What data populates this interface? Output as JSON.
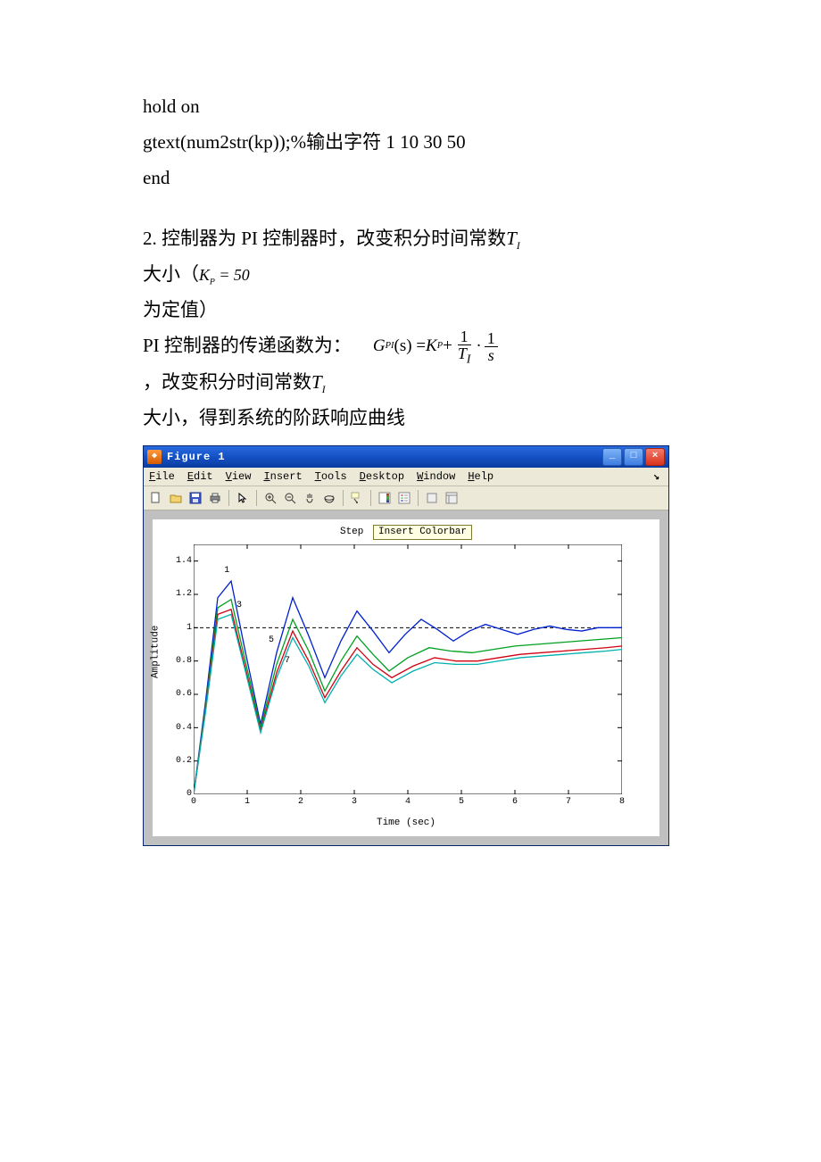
{
  "code": {
    "line1": " hold on",
    "line2": " gtext(num2str(kp));%输出字符 1 10 30 50",
    "line3": "end"
  },
  "section2": {
    "heading_prefix": "2. 控制器为 PI 控制器时，改变积分时间常数",
    "ti_var": "T",
    "ti_sub": "I",
    "size_prefix": "大小（",
    "kp_eq_lhs": "K",
    "kp_eq_sub": "P",
    "kp_eq": " = 50",
    "fixed_value": "为定值）",
    "tf_label": "PI 控制器的传递函数为：",
    "formula": {
      "lhs": "G",
      "lhs_sub": "PI",
      "of_s": "(s) = ",
      "kp": "K",
      "kp_sub": "P",
      "plus": " + ",
      "dot": " · "
    },
    "change_prefix": "，改变积分时间常数",
    "result_line": "大小，得到系统的阶跃响应曲线"
  },
  "figure": {
    "title": "Figure 1",
    "menu": [
      "File",
      "Edit",
      "View",
      "Insert",
      "Tools",
      "Desktop",
      "Window",
      "Help"
    ],
    "plot_title": "Step",
    "tooltip": "Insert Colorbar",
    "ylabel": "Amplitude",
    "xlabel": "Time (sec)",
    "yticks": [
      "0",
      "0.2",
      "0.4",
      "0.6",
      "0.8",
      "1",
      "1.2",
      "1.4"
    ],
    "xticks": [
      "0",
      "1",
      "2",
      "3",
      "4",
      "5",
      "6",
      "7",
      "8"
    ],
    "annotations": [
      "1",
      "3",
      "5",
      "7"
    ]
  },
  "chart_data": {
    "type": "line",
    "title": "Step",
    "xlabel": "Time (sec)",
    "ylabel": "Amplitude",
    "xlim": [
      0,
      8
    ],
    "ylim": [
      0,
      1.5
    ],
    "reference_line": 1.0,
    "annotations": [
      {
        "label": "1",
        "x": 0.62,
        "y": 1.32
      },
      {
        "label": "3",
        "x": 0.85,
        "y": 1.11
      },
      {
        "label": "5",
        "x": 1.45,
        "y": 0.9
      },
      {
        "label": "7",
        "x": 1.75,
        "y": 0.78
      }
    ],
    "series": [
      {
        "name": "Ti=1",
        "color": "#0020d0",
        "x": [
          0,
          0.22,
          0.45,
          0.7,
          0.95,
          1.25,
          1.55,
          1.85,
          2.15,
          2.45,
          2.75,
          3.05,
          3.35,
          3.65,
          3.95,
          4.25,
          4.55,
          4.85,
          5.15,
          5.45,
          5.75,
          6.05,
          6.35,
          6.65,
          6.95,
          7.25,
          7.55,
          7.85,
          8.0
        ],
        "y": [
          0,
          0.55,
          1.18,
          1.28,
          0.88,
          0.42,
          0.85,
          1.18,
          0.95,
          0.7,
          0.92,
          1.1,
          0.98,
          0.85,
          0.96,
          1.05,
          0.99,
          0.92,
          0.98,
          1.02,
          0.99,
          0.96,
          0.99,
          1.01,
          0.99,
          0.98,
          1.0,
          1.0,
          1.0
        ]
      },
      {
        "name": "Ti=3",
        "color": "#00a020",
        "x": [
          0,
          0.22,
          0.45,
          0.7,
          0.95,
          1.25,
          1.55,
          1.85,
          2.15,
          2.45,
          2.75,
          3.05,
          3.35,
          3.65,
          4.0,
          4.4,
          4.8,
          5.2,
          5.6,
          6.0,
          6.4,
          6.8,
          7.2,
          7.6,
          8.0
        ],
        "y": [
          0,
          0.52,
          1.12,
          1.17,
          0.82,
          0.4,
          0.78,
          1.05,
          0.86,
          0.62,
          0.8,
          0.95,
          0.84,
          0.74,
          0.82,
          0.88,
          0.86,
          0.85,
          0.87,
          0.89,
          0.9,
          0.91,
          0.92,
          0.93,
          0.94
        ]
      },
      {
        "name": "Ti=5",
        "color": "#d00010",
        "x": [
          0,
          0.22,
          0.45,
          0.7,
          0.95,
          1.25,
          1.55,
          1.85,
          2.15,
          2.45,
          2.75,
          3.05,
          3.35,
          3.7,
          4.1,
          4.5,
          4.9,
          5.3,
          5.7,
          6.1,
          6.5,
          6.9,
          7.3,
          7.7,
          8.0
        ],
        "y": [
          0,
          0.5,
          1.08,
          1.11,
          0.78,
          0.38,
          0.73,
          0.98,
          0.8,
          0.58,
          0.74,
          0.88,
          0.78,
          0.7,
          0.77,
          0.82,
          0.8,
          0.8,
          0.82,
          0.84,
          0.85,
          0.86,
          0.87,
          0.88,
          0.89
        ]
      },
      {
        "name": "Ti=7",
        "color": "#00b0b0",
        "x": [
          0,
          0.22,
          0.45,
          0.7,
          0.95,
          1.25,
          1.55,
          1.85,
          2.15,
          2.45,
          2.75,
          3.05,
          3.35,
          3.7,
          4.1,
          4.5,
          4.9,
          5.3,
          5.7,
          6.1,
          6.5,
          6.9,
          7.3,
          7.7,
          8.0
        ],
        "y": [
          0,
          0.49,
          1.05,
          1.08,
          0.76,
          0.37,
          0.7,
          0.94,
          0.77,
          0.55,
          0.71,
          0.84,
          0.75,
          0.67,
          0.74,
          0.79,
          0.78,
          0.78,
          0.8,
          0.82,
          0.83,
          0.84,
          0.85,
          0.86,
          0.87
        ]
      }
    ]
  }
}
